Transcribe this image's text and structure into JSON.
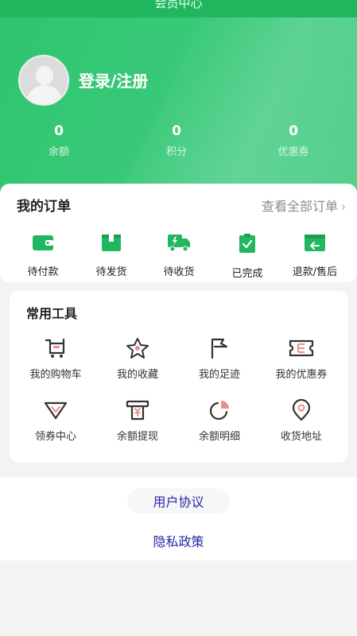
{
  "header": {
    "title": "会员中心",
    "login_label": "登录/注册",
    "stats": [
      {
        "value": "0",
        "label": "余额"
      },
      {
        "value": "0",
        "label": "积分"
      },
      {
        "value": "0",
        "label": "优惠券"
      }
    ]
  },
  "orders": {
    "title": "我的订单",
    "view_all": "查看全部订单",
    "items": [
      {
        "label": "待付款",
        "icon": "wallet-icon"
      },
      {
        "label": "待发货",
        "icon": "package-icon"
      },
      {
        "label": "待收货",
        "icon": "truck-icon"
      },
      {
        "label": "已完成",
        "icon": "clipboard-check-icon"
      },
      {
        "label": "退款/售后",
        "icon": "refund-icon"
      }
    ]
  },
  "tools": {
    "title": "常用工具",
    "items": [
      {
        "label": "我的购物车",
        "icon": "cart-icon"
      },
      {
        "label": "我的收藏",
        "icon": "star-icon"
      },
      {
        "label": "我的足迹",
        "icon": "flag-icon"
      },
      {
        "label": "我的优惠券",
        "icon": "coupon-icon"
      },
      {
        "label": "领券中心",
        "icon": "diamond-icon"
      },
      {
        "label": "余额提现",
        "icon": "withdraw-icon"
      },
      {
        "label": "余额明细",
        "icon": "pie-icon"
      },
      {
        "label": "收货地址",
        "icon": "location-icon"
      }
    ]
  },
  "links": {
    "user_agreement": "用户协议",
    "privacy_policy": "隐私政策"
  },
  "colors": {
    "brand_green": "#21b75f",
    "accent_pink": "#f08b8b",
    "link_blue": "#2626a8"
  }
}
